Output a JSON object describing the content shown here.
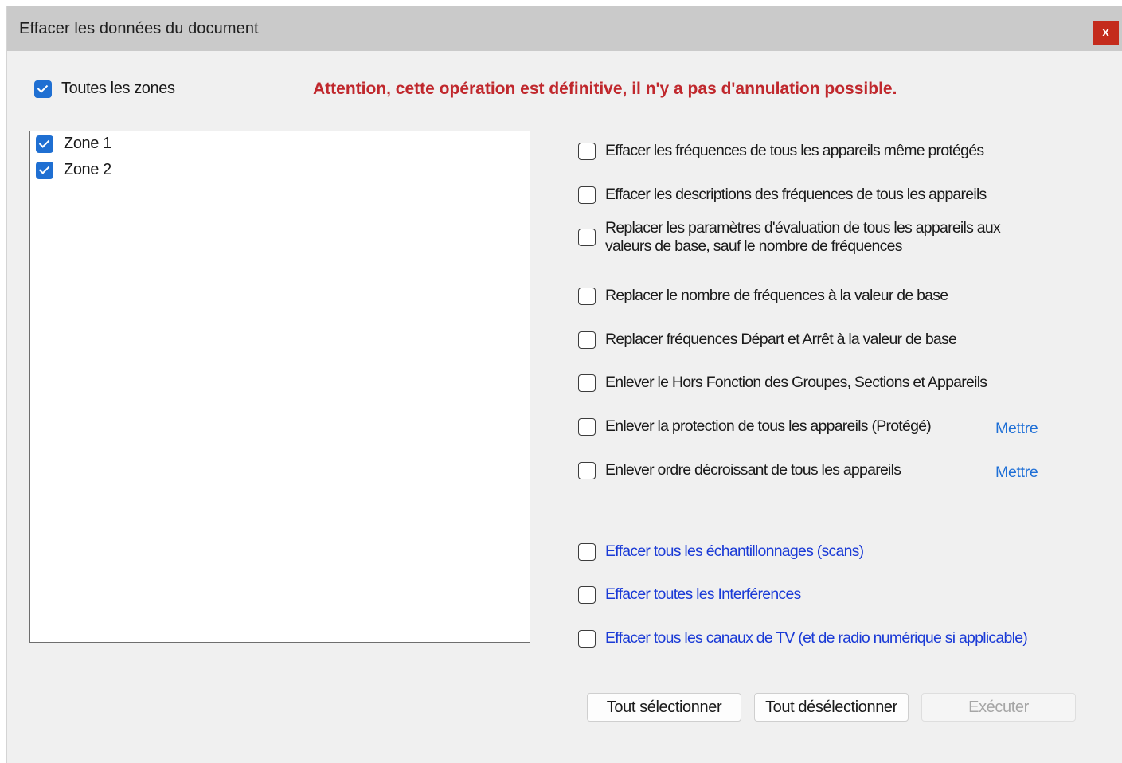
{
  "window": {
    "title": "Effacer les données du document",
    "close_label": "x"
  },
  "zones": {
    "all_label": "Toutes les zones",
    "all_checked": true,
    "items": [
      {
        "label": "Zone 1",
        "checked": true
      },
      {
        "label": "Zone 2",
        "checked": true
      }
    ]
  },
  "warning": "Attention, cette opération est définitive, il n'y a pas d'annulation possible.",
  "options": [
    {
      "label": "Effacer les fréquences de tous les appareils même protégés",
      "checked": false
    },
    {
      "label": "Effacer les descriptions des fréquences de tous les appareils",
      "checked": false
    },
    {
      "label_line1": "Replacer les paramètres d'évaluation de tous les appareils aux",
      "label_line2": "valeurs de base, sauf le nombre de fréquences",
      "checked": false
    },
    {
      "label": "Replacer le nombre de fréquences à la valeur de base",
      "checked": false
    },
    {
      "label": "Replacer fréquences Départ et Arrêt à la valeur de base",
      "checked": false
    },
    {
      "label": "Enlever le Hors Fonction des Groupes, Sections et Appareils",
      "checked": false
    },
    {
      "label": "Enlever la protection de tous les appareils (Protégé)",
      "checked": false,
      "link": "Mettre"
    },
    {
      "label": "Enlever ordre décroissant de tous les appareils",
      "checked": false,
      "link": "Mettre"
    }
  ],
  "advanced_options": [
    {
      "label": "Effacer tous les échantillonnages (scans)",
      "checked": false
    },
    {
      "label": "Effacer toutes les Interférences",
      "checked": false
    },
    {
      "label": "Effacer tous les canaux de TV (et de radio numérique si applicable)",
      "checked": false
    }
  ],
  "buttons": {
    "select_all": "Tout sélectionner",
    "deselect_all": "Tout désélectionner",
    "execute": "Exécuter"
  },
  "colors": {
    "warning": "#c0282d",
    "checkbox_checked": "#1f6fd2",
    "link": "#1e6fd6",
    "advanced_label": "#1a3ad6",
    "close_button": "#c42b1c"
  }
}
